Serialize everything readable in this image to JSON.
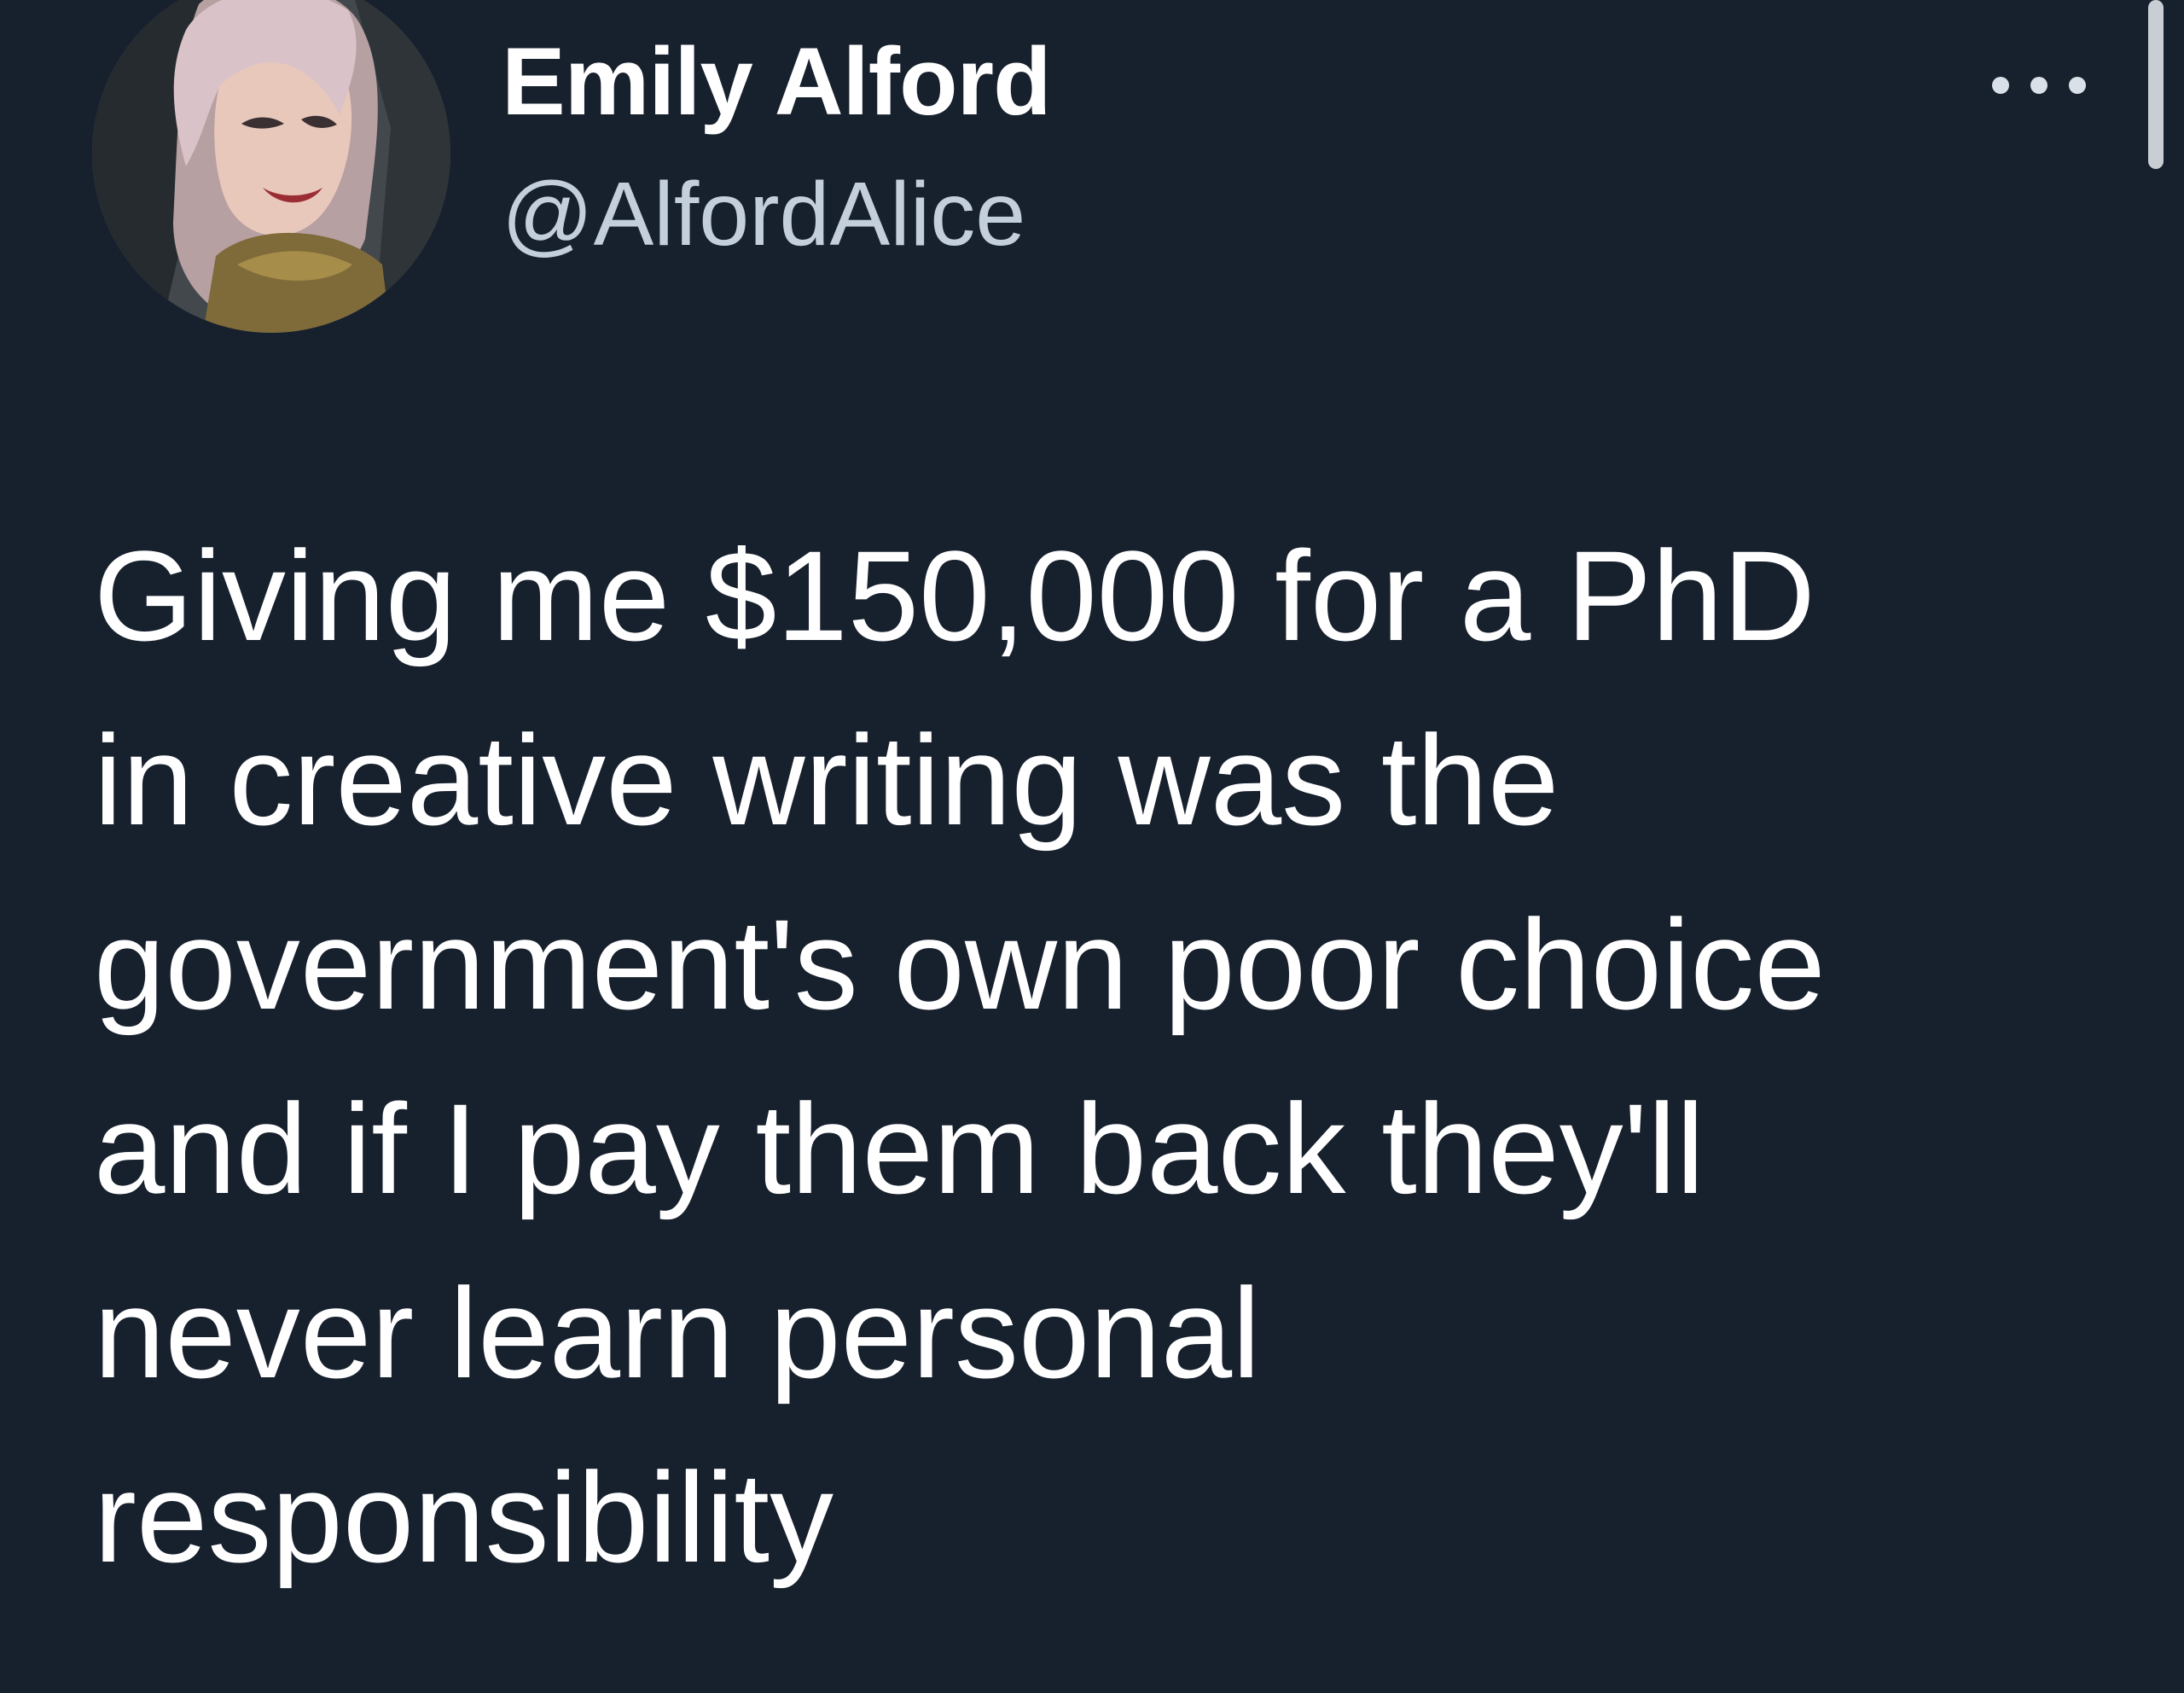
{
  "tweet": {
    "author": {
      "display_name": "Emily Alford",
      "handle": "@AlfordAlice",
      "avatar_icon": "profile-photo"
    },
    "more_icon": "ellipsis-icon",
    "text": "Giving me $150,000 for a PhD\nin creative writing was the\ngovernment's own poor choice\nand if I pay them back they'll\nnever learn personal\nresponsibility"
  },
  "colors": {
    "background": "#17202d",
    "name": "#ffffff",
    "handle": "#c3cfdb",
    "body_text": "#ffffff",
    "icon": "#d9e0e7"
  }
}
